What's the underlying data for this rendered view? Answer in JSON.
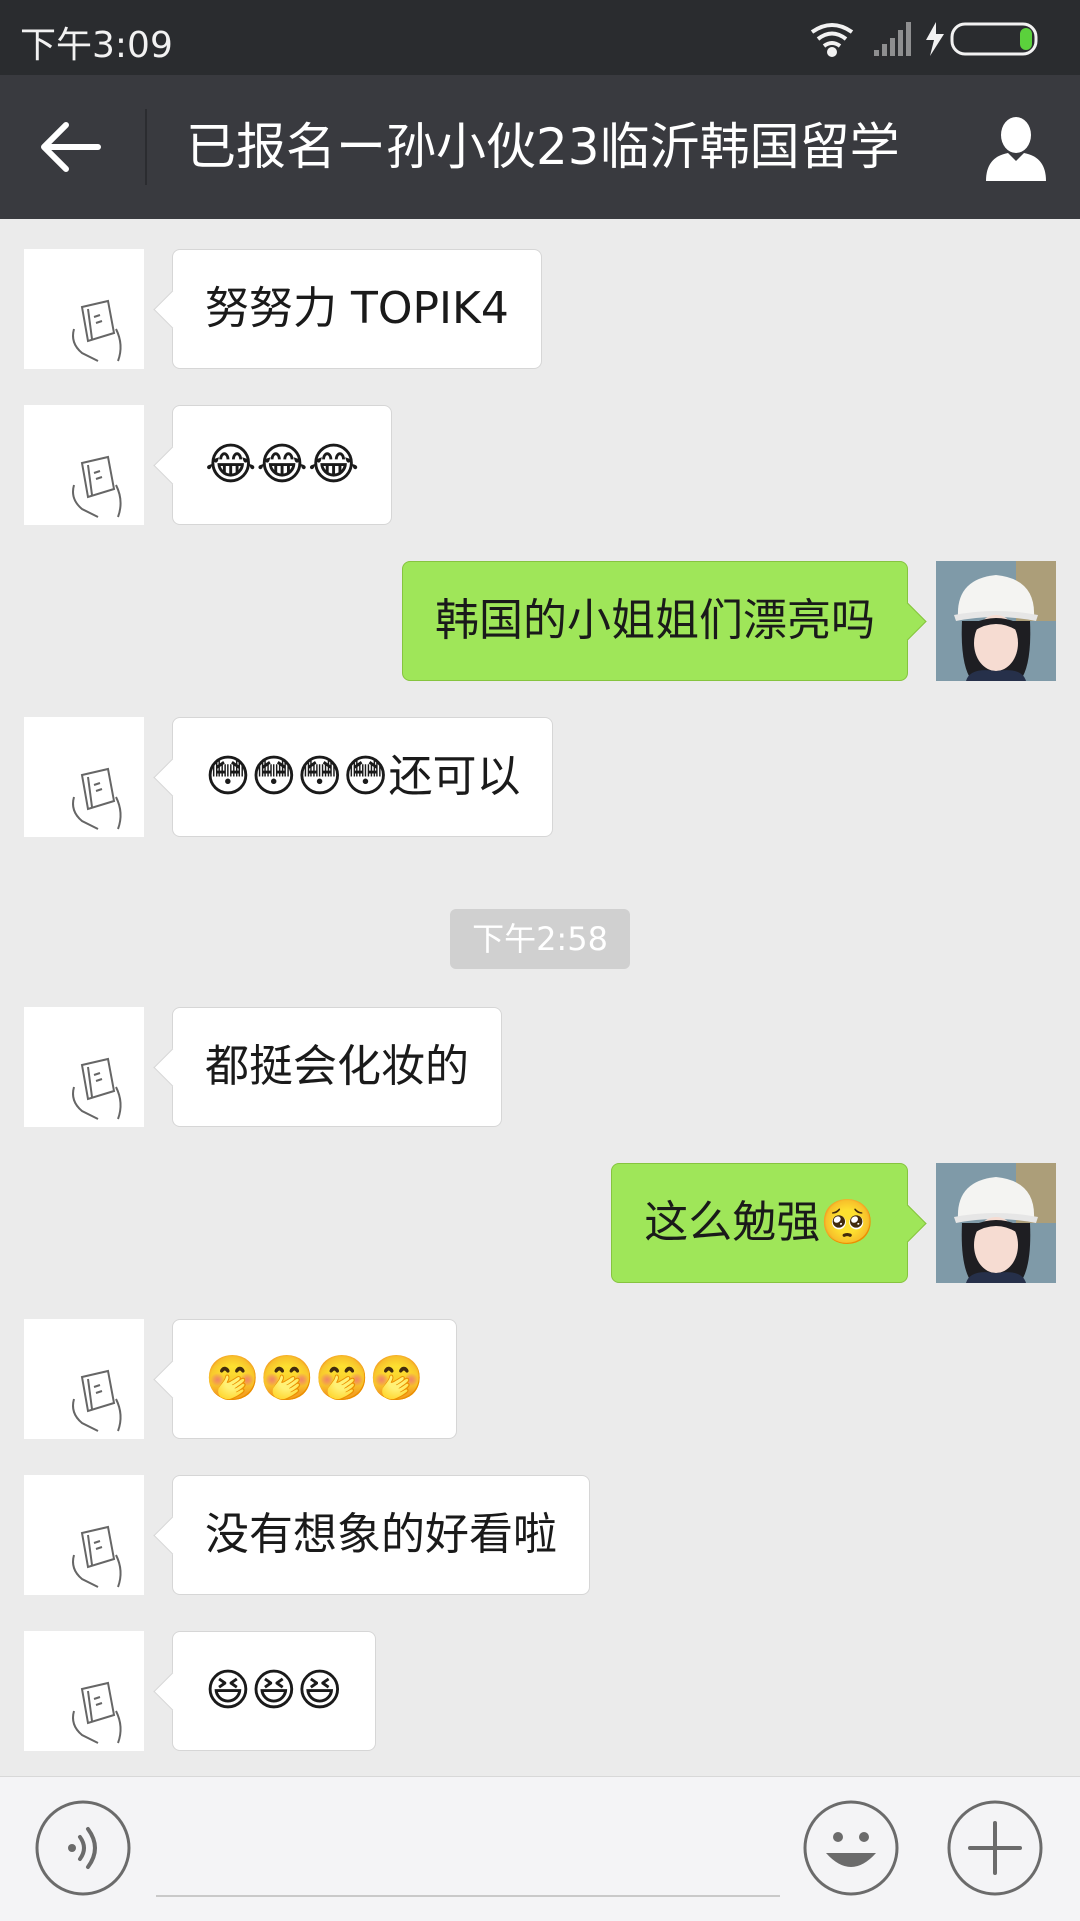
{
  "status_bar": {
    "time": "下午3:09"
  },
  "header": {
    "title": "已报名ー孙小伙23临沂韩国留学"
  },
  "messages": [
    {
      "side": "left",
      "text": "努努力  TOPIK4"
    },
    {
      "side": "left",
      "text": "😂😂😂"
    },
    {
      "side": "right",
      "text": "韩国的小姐姐们漂亮吗"
    },
    {
      "side": "left",
      "text": "😳😳😳😳还可以"
    },
    {
      "side": "left",
      "text": "都挺会化妆的"
    },
    {
      "side": "right",
      "text": "这么勉强🥺"
    },
    {
      "side": "left",
      "text": "🤭🤭🤭🤭"
    },
    {
      "side": "left",
      "text": "没有想象的好看啦"
    },
    {
      "side": "left",
      "text": "😆😆😆"
    }
  ],
  "timestamp": "下午2:58",
  "icons": {
    "back": "back-arrow-icon",
    "profile": "person-icon",
    "voice": "voice-icon",
    "emoji": "emoji-icon",
    "plus": "plus-icon"
  },
  "colors": {
    "header_bg": "#393a3f",
    "chat_bg": "#ebebeb",
    "sent_bubble": "#9fe659",
    "received_bubble": "#ffffff"
  }
}
